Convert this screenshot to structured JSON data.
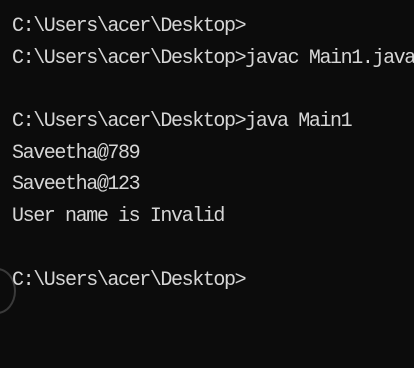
{
  "terminal": {
    "lines": [
      "C:\\Users\\acer\\Desktop>",
      "C:\\Users\\acer\\Desktop>javac Main1.java",
      "",
      "C:\\Users\\acer\\Desktop>java Main1",
      "Saveetha@789",
      "Saveetha@123",
      "User name is Invalid",
      "",
      "C:\\Users\\acer\\Desktop>"
    ]
  },
  "colors": {
    "background": "#0c0c0c",
    "text": "#d6d6d6"
  }
}
